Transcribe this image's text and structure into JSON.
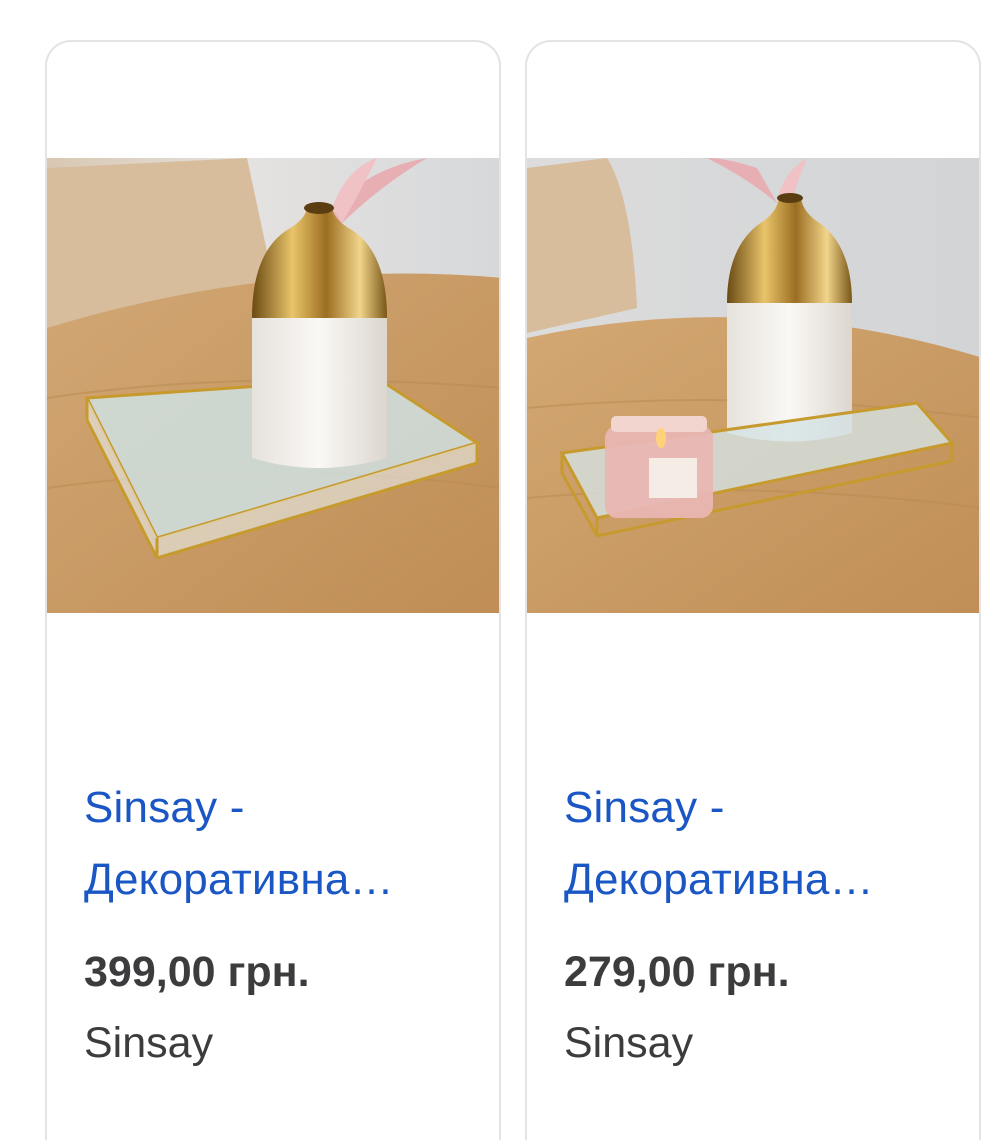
{
  "products": [
    {
      "title_line1": "Sinsay -",
      "title_line2": "Декоративна…",
      "price": "399,00 грн.",
      "merchant": "Sinsay",
      "image_icon": "vase-on-mirror-tray-photo"
    },
    {
      "title_line1": "Sinsay -",
      "title_line2": "Декоративна…",
      "price": "279,00 грн.",
      "merchant": "Sinsay",
      "image_icon": "vase-and-candle-on-mirror-tray-photo"
    }
  ],
  "colors": {
    "link": "#1a56c4",
    "text": "#3c3c3f",
    "card_border": "#e3e3e6",
    "gold": "#c79a2e",
    "wood": "#c89a62"
  }
}
